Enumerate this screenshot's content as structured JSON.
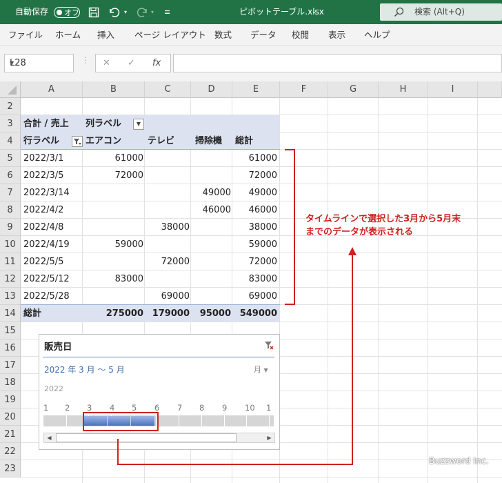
{
  "titlebar": {
    "autosave_label": "自動保存",
    "autosave_state": "オフ",
    "filename": "ピボットテーブル.xlsx",
    "search_placeholder": "検索 (Alt+Q)"
  },
  "menu": [
    "ファイル",
    "ホーム",
    "挿入",
    "ページ レイアウト",
    "数式",
    "データ",
    "校閲",
    "表示",
    "ヘルプ"
  ],
  "namebox": "L28",
  "formula_icons": {
    "cancel": "✕",
    "enter": "✓",
    "fx": "fx"
  },
  "columns": [
    "A",
    "B",
    "C",
    "D",
    "E",
    "F",
    "G",
    "H",
    "I"
  ],
  "rows": [
    "2",
    "3",
    "4",
    "5",
    "6",
    "7",
    "8",
    "9",
    "10",
    "11",
    "12",
    "13",
    "14",
    "15",
    "16",
    "17",
    "18",
    "19",
    "20",
    "21",
    "22",
    "23"
  ],
  "pivot": {
    "sum_label": "合計 / 売上",
    "col_labels": "列ラベル",
    "row_labels": "行ラベル",
    "headers": [
      "エアコン",
      "テレビ",
      "掃除機",
      "総計"
    ],
    "rows": [
      {
        "date": "2022/3/1",
        "ac": "61000",
        "tv": "",
        "vac": "",
        "total": "61000"
      },
      {
        "date": "2022/3/5",
        "ac": "72000",
        "tv": "",
        "vac": "",
        "total": "72000"
      },
      {
        "date": "2022/3/14",
        "ac": "",
        "tv": "",
        "vac": "49000",
        "total": "49000"
      },
      {
        "date": "2022/4/2",
        "ac": "",
        "tv": "",
        "vac": "46000",
        "total": "46000"
      },
      {
        "date": "2022/4/8",
        "ac": "",
        "tv": "38000",
        "vac": "",
        "total": "38000"
      },
      {
        "date": "2022/4/19",
        "ac": "59000",
        "tv": "",
        "vac": "",
        "total": "59000"
      },
      {
        "date": "2022/5/5",
        "ac": "",
        "tv": "72000",
        "vac": "",
        "total": "72000"
      },
      {
        "date": "2022/5/12",
        "ac": "83000",
        "tv": "",
        "vac": "",
        "total": "83000"
      },
      {
        "date": "2022/5/28",
        "ac": "",
        "tv": "69000",
        "vac": "",
        "total": "69000"
      }
    ],
    "grand": {
      "label": "総計",
      "ac": "275000",
      "tv": "179000",
      "vac": "95000",
      "total": "549000"
    }
  },
  "annotation": {
    "line1": "タイムラインで選択した3月から5月末",
    "line2": "までのデータが表示される",
    "color": "#d02020"
  },
  "timeline": {
    "title": "販売日",
    "range": "2022 年 3 月 ～ 5 月",
    "unit": "月",
    "year": "2022",
    "months": [
      "1",
      "2",
      "3",
      "4",
      "5",
      "6",
      "7",
      "8",
      "9",
      "10",
      "1"
    ],
    "selected_start_month": 3,
    "selected_end_month": 5
  },
  "watermark": "Buzzword Inc.",
  "colors": {
    "accent": "#217346",
    "pivot_band": "#dce2f0",
    "timeline_sel": "#4a71c0"
  }
}
